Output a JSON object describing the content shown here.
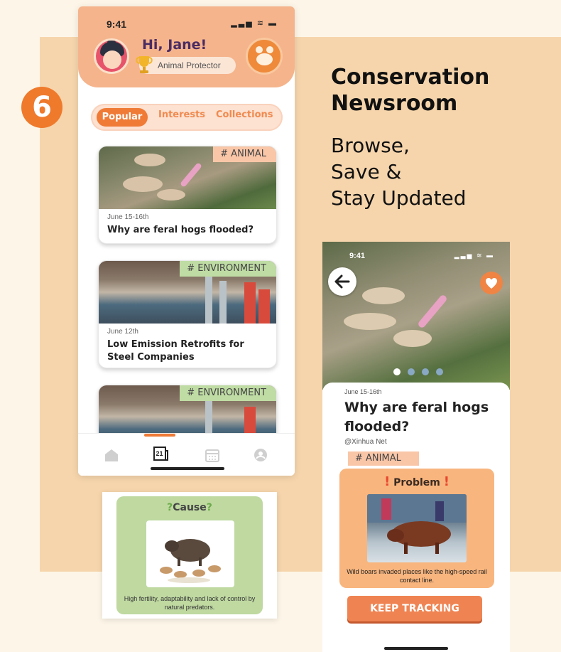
{
  "step_number": "6",
  "title_line1": "Conservation",
  "title_line2": "Newsroom",
  "subtitle_line1": "Browse,",
  "subtitle_line2": "Save &",
  "subtitle_line3": "Stay Updated",
  "phone_list": {
    "status_time": "9:41",
    "status_icons": "▂▃▅ ≋ ▬",
    "greeting": "Hi, Jane!",
    "role": "Animal Protector",
    "tabs": [
      {
        "label": "Popular",
        "active": true
      },
      {
        "label": "Interests",
        "active": false
      },
      {
        "label": "Collections",
        "active": false
      }
    ],
    "cards": [
      {
        "tag": "# ANIMAL",
        "date": "June 15-16th",
        "title": "Why are feral hogs flooded?"
      },
      {
        "tag": "# ENVIRONMENT",
        "date": "June 12th",
        "title": "Low Emission Retrofits for Steel Companies"
      },
      {
        "tag": "# ENVIRONMENT",
        "date": "",
        "title": ""
      }
    ],
    "nav_icons": [
      "home-icon",
      "news-icon",
      "calendar-icon",
      "profile-icon"
    ],
    "nav_news_label": "21"
  },
  "cause_card": {
    "title": "Cause",
    "text": "High fertility, adaptability and lack of control by natural predators."
  },
  "phone_detail": {
    "status_time": "9:41",
    "status_icons": "▂▃▅ ≋ ▬",
    "date": "June 15-16th",
    "title": "Why are feral hogs flooded?",
    "source": "@Xinhua Net",
    "tag": "# ANIMAL",
    "problem_title": "Problem",
    "problem_text": "Wild boars invaded places like the high-speed rail contact line.",
    "button_label": "KEEP TRACKING"
  },
  "colors": {
    "accent": "#ef7b37",
    "panel": "#f6d5ac",
    "background": "#fdf6e8",
    "tag_animal": "#f9c6a8",
    "tag_environment": "#bfdca4"
  }
}
